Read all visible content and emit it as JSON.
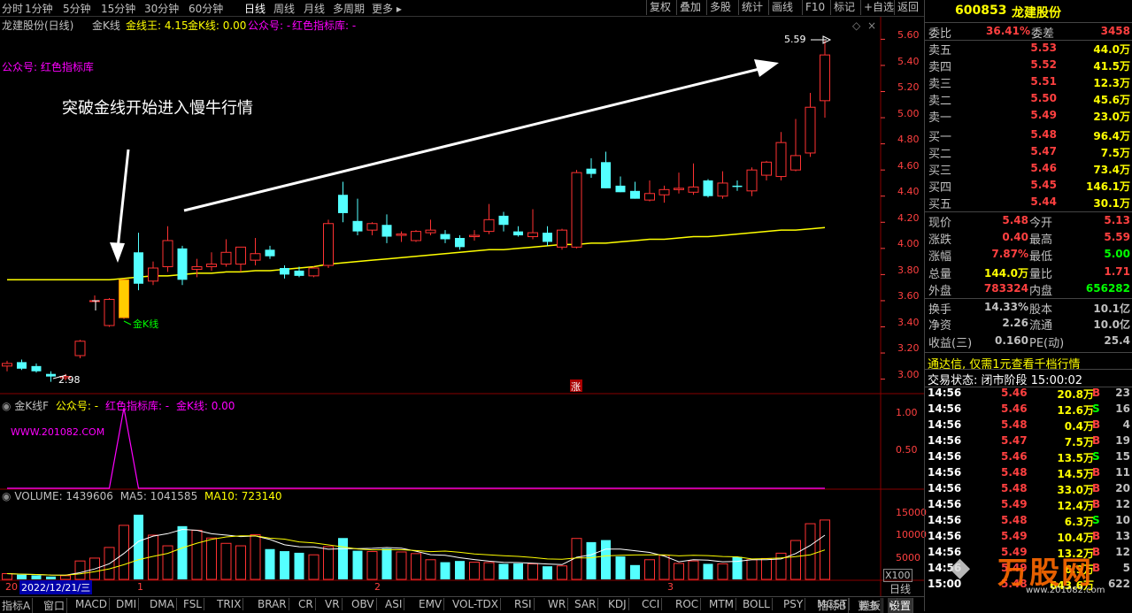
{
  "toolbar": {
    "periods": [
      "分时",
      "1分钟",
      "5分钟",
      "15分钟",
      "30分钟",
      "60分钟",
      "日线",
      "周线",
      "月线",
      "多周期",
      "更多 ▸"
    ],
    "active_period": "日线",
    "buttons": [
      "复权",
      "叠加",
      "多股",
      "统计",
      "画线",
      "F10",
      "标记",
      "+自选",
      "返回"
    ]
  },
  "main_header": {
    "stock": "龙建股份(日线)",
    "indicator": "金K线",
    "jxw_label": "金线王: 4.15",
    "jk_label": "金K线: 0.00",
    "gzh_label": "公众号: -",
    "red_label": "红色指标库: -",
    "side_label": "公众号: 红色指标库"
  },
  "annotations": {
    "headline": "突破金线开始进入慢牛行情",
    "jk_tag": "金K线",
    "high_mark": "5.59",
    "low_mark": "2.98",
    "zhang": "涨"
  },
  "price_axis": [
    "5.60",
    "5.40",
    "5.20",
    "5.00",
    "4.80",
    "4.60",
    "4.40",
    "4.20",
    "4.00",
    "3.80",
    "3.60",
    "3.40",
    "3.20",
    "3.00"
  ],
  "sub_header": {
    "name": "金K线F",
    "gzh": "公众号: -",
    "red": "红色指标库: -",
    "jk": "金K线: 0.00",
    "watermark": "WWW.201082.COM",
    "axis": [
      "1.00",
      "0.50"
    ]
  },
  "volume_header": {
    "volume": "VOLUME: 1439606",
    "ma5": "MA5: 1041585",
    "ma10": "MA10: 723140",
    "axis": [
      "15000",
      "10000",
      "5000"
    ],
    "unit": "X100"
  },
  "date_axis": {
    "date": "2022/12/21/三",
    "months": [
      "1",
      "2",
      "3"
    ],
    "left_fragment": "20"
  },
  "period_label": "日线",
  "stock_panel": {
    "code": "600853",
    "name": "龙建股份",
    "webi_label": "委比",
    "webi": "36.41%",
    "weicha_label": "委差",
    "weicha": "3458",
    "asks": [
      {
        "label": "卖五",
        "price": "5.53",
        "vol": "44.0万"
      },
      {
        "label": "卖四",
        "price": "5.52",
        "vol": "41.5万"
      },
      {
        "label": "卖三",
        "price": "5.51",
        "vol": "12.3万"
      },
      {
        "label": "卖二",
        "price": "5.50",
        "vol": "45.6万"
      },
      {
        "label": "卖一",
        "price": "5.49",
        "vol": "23.0万"
      }
    ],
    "bids": [
      {
        "label": "买一",
        "price": "5.48",
        "vol": "96.4万"
      },
      {
        "label": "买二",
        "price": "5.47",
        "vol": "7.5万"
      },
      {
        "label": "买三",
        "price": "5.46",
        "vol": "73.4万"
      },
      {
        "label": "买四",
        "price": "5.45",
        "vol": "146.1万"
      },
      {
        "label": "买五",
        "price": "5.44",
        "vol": "30.1万"
      }
    ],
    "stats": [
      {
        "l1": "现价",
        "v1": "5.48",
        "c1": "#ff4040",
        "l2": "今开",
        "v2": "5.13",
        "c2": "#ff4040"
      },
      {
        "l1": "涨跌",
        "v1": "0.40",
        "c1": "#ff4040",
        "l2": "最高",
        "v2": "5.59",
        "c2": "#ff4040"
      },
      {
        "l1": "涨幅",
        "v1": "7.87%",
        "c1": "#ff4040",
        "l2": "最低",
        "v2": "5.00",
        "c2": "#00ff00"
      },
      {
        "l1": "总量",
        "v1": "144.0万",
        "c1": "#ffff00",
        "l2": "量比",
        "v2": "1.71",
        "c2": "#ff4040"
      },
      {
        "l1": "外盘",
        "v1": "783324",
        "c1": "#ff4040",
        "l2": "内盘",
        "v2": "656282",
        "c2": "#00ff00"
      },
      {
        "l1": "换手",
        "v1": "14.33%",
        "c1": "#c0c0c0",
        "l2": "股本",
        "v2": "10.1亿",
        "c2": "#c0c0c0"
      },
      {
        "l1": "净资",
        "v1": "2.26",
        "c1": "#c0c0c0",
        "l2": "流通",
        "v2": "10.0亿",
        "c2": "#c0c0c0"
      },
      {
        "l1": "收益(三)",
        "v1": "0.160",
        "c1": "#c0c0c0",
        "l2": "PE(动)",
        "v2": "25.4",
        "c2": "#c0c0c0"
      }
    ],
    "promo": "通达信, 仅需1元查看千档行情",
    "status": "交易状态: 闭市阶段 15:00:02",
    "ticks": [
      {
        "t": "14:56",
        "p": "5.46",
        "v": "20.8万",
        "s": "B",
        "n": "23"
      },
      {
        "t": "14:56",
        "p": "5.46",
        "v": "12.6万",
        "s": "S",
        "n": "16"
      },
      {
        "t": "14:56",
        "p": "5.48",
        "v": "0.4万",
        "s": "B",
        "n": "4"
      },
      {
        "t": "14:56",
        "p": "5.47",
        "v": "7.5万",
        "s": "B",
        "n": "19"
      },
      {
        "t": "14:56",
        "p": "5.46",
        "v": "13.5万",
        "s": "S",
        "n": "15"
      },
      {
        "t": "14:56",
        "p": "5.48",
        "v": "14.5万",
        "s": "B",
        "n": "11"
      },
      {
        "t": "14:56",
        "p": "5.48",
        "v": "33.0万",
        "s": "B",
        "n": "20"
      },
      {
        "t": "14:56",
        "p": "5.49",
        "v": "12.4万",
        "s": "B",
        "n": "12"
      },
      {
        "t": "14:56",
        "p": "5.48",
        "v": "6.3万",
        "s": "S",
        "n": "10"
      },
      {
        "t": "14:56",
        "p": "5.49",
        "v": "10.4万",
        "s": "B",
        "n": "13"
      },
      {
        "t": "14:56",
        "p": "5.49",
        "v": "13.2万",
        "s": "B",
        "n": "12"
      },
      {
        "t": "14:56",
        "p": "5.49",
        "v": "6.9万",
        "s": "B",
        "n": "5"
      },
      {
        "t": "15:00",
        "p": "5.48",
        "v": "643.6万",
        "s": "",
        "n": "622"
      }
    ],
    "logo_text": "万股网",
    "logo_url": "www.201082.com"
  },
  "bottom_tabs": [
    "指标A",
    "窗口",
    "MACD",
    "DMI",
    "DMA",
    "FSL",
    "TRIX",
    "BRAR",
    "CR",
    "VR",
    "OBV",
    "ASI",
    "EMV",
    "VOL-TDX",
    "RSI",
    "WR",
    "SAR",
    "KDJ",
    "CCI",
    "ROC",
    "MTM",
    "BOLL",
    "PSY",
    "MCST",
    "更多",
    "设置"
  ],
  "active_tab": "设置",
  "bottom_right_tabs": [
    "指标B",
    "模板",
    "▸"
  ],
  "colors": {
    "up": "#ff3232",
    "down": "#54ffff",
    "gold": "#ffff00",
    "magenta": "#ff00ff",
    "grid": "#880000"
  },
  "chart_data": {
    "type": "candlestick",
    "ylim": [
      2.95,
      5.65
    ],
    "candles": [
      {
        "o": 3.1,
        "h": 3.14,
        "l": 3.06,
        "c": 3.12
      },
      {
        "o": 3.13,
        "h": 3.15,
        "l": 3.07,
        "c": 3.08
      },
      {
        "o": 3.1,
        "h": 3.12,
        "l": 3.05,
        "c": 3.06
      },
      {
        "o": 3.04,
        "h": 3.06,
        "l": 2.98,
        "c": 3.02
      },
      {
        "o": 3.01,
        "h": 3.04,
        "l": 2.99,
        "c": 3.02
      },
      {
        "o": 3.18,
        "h": 3.3,
        "l": 3.16,
        "c": 3.29
      },
      {
        "o": 3.6,
        "h": 3.64,
        "l": 3.59,
        "c": 3.6
      },
      {
        "o": 3.41,
        "h": 3.62,
        "l": 3.4,
        "c": 3.61
      },
      {
        "o": 3.47,
        "h": 3.77,
        "l": 3.46,
        "c": 3.76
      },
      {
        "o": 3.97,
        "h": 4.12,
        "l": 3.68,
        "c": 3.73
      },
      {
        "o": 3.75,
        "h": 3.9,
        "l": 3.72,
        "c": 3.85
      },
      {
        "o": 3.86,
        "h": 4.17,
        "l": 3.82,
        "c": 4.06
      },
      {
        "o": 4.0,
        "h": 4.02,
        "l": 3.72,
        "c": 3.76
      },
      {
        "o": 3.84,
        "h": 3.92,
        "l": 3.78,
        "c": 3.86
      },
      {
        "o": 3.86,
        "h": 3.97,
        "l": 3.83,
        "c": 3.88
      },
      {
        "o": 3.88,
        "h": 4.07,
        "l": 3.86,
        "c": 3.97
      },
      {
        "o": 3.88,
        "h": 4.0,
        "l": 3.82,
        "c": 4.01
      },
      {
        "o": 3.91,
        "h": 4.08,
        "l": 3.87,
        "c": 3.96
      },
      {
        "o": 3.99,
        "h": 4.02,
        "l": 3.92,
        "c": 3.94
      },
      {
        "o": 3.85,
        "h": 3.87,
        "l": 3.77,
        "c": 3.8
      },
      {
        "o": 3.83,
        "h": 3.86,
        "l": 3.78,
        "c": 3.79
      },
      {
        "o": 3.79,
        "h": 3.86,
        "l": 3.78,
        "c": 3.85
      },
      {
        "o": 3.87,
        "h": 4.22,
        "l": 3.85,
        "c": 4.19
      },
      {
        "o": 4.41,
        "h": 4.51,
        "l": 4.2,
        "c": 4.27
      },
      {
        "o": 4.21,
        "h": 4.38,
        "l": 4.1,
        "c": 4.13
      },
      {
        "o": 4.14,
        "h": 4.2,
        "l": 4.1,
        "c": 4.19
      },
      {
        "o": 4.18,
        "h": 4.26,
        "l": 4.04,
        "c": 4.09
      },
      {
        "o": 4.1,
        "h": 4.13,
        "l": 4.05,
        "c": 4.11
      },
      {
        "o": 4.06,
        "h": 4.14,
        "l": 4.05,
        "c": 4.13
      },
      {
        "o": 4.12,
        "h": 4.22,
        "l": 4.1,
        "c": 4.14
      },
      {
        "o": 4.11,
        "h": 4.14,
        "l": 4.04,
        "c": 4.07
      },
      {
        "o": 4.08,
        "h": 4.1,
        "l": 3.99,
        "c": 4.01
      },
      {
        "o": 4.09,
        "h": 4.14,
        "l": 4.06,
        "c": 4.1
      },
      {
        "o": 4.13,
        "h": 4.34,
        "l": 4.11,
        "c": 4.22
      },
      {
        "o": 4.25,
        "h": 4.28,
        "l": 4.13,
        "c": 4.18
      },
      {
        "o": 4.13,
        "h": 4.17,
        "l": 4.09,
        "c": 4.1
      },
      {
        "o": 4.09,
        "h": 4.3,
        "l": 4.07,
        "c": 4.12
      },
      {
        "o": 4.12,
        "h": 4.17,
        "l": 4.02,
        "c": 4.05
      },
      {
        "o": 4.01,
        "h": 4.15,
        "l": 3.99,
        "c": 4.14
      },
      {
        "o": 4.01,
        "h": 4.6,
        "l": 4.0,
        "c": 4.58
      },
      {
        "o": 4.61,
        "h": 4.69,
        "l": 4.54,
        "c": 4.57
      },
      {
        "o": 4.66,
        "h": 4.74,
        "l": 4.46,
        "c": 4.46
      },
      {
        "o": 4.48,
        "h": 4.55,
        "l": 4.43,
        "c": 4.43
      },
      {
        "o": 4.44,
        "h": 4.51,
        "l": 4.38,
        "c": 4.38
      },
      {
        "o": 4.37,
        "h": 4.52,
        "l": 4.36,
        "c": 4.42
      },
      {
        "o": 4.41,
        "h": 4.48,
        "l": 4.35,
        "c": 4.45
      },
      {
        "o": 4.45,
        "h": 4.58,
        "l": 4.42,
        "c": 4.46
      },
      {
        "o": 4.43,
        "h": 4.65,
        "l": 4.41,
        "c": 4.47
      },
      {
        "o": 4.52,
        "h": 4.53,
        "l": 4.39,
        "c": 4.4
      },
      {
        "o": 4.4,
        "h": 4.59,
        "l": 4.38,
        "c": 4.5
      },
      {
        "o": 4.48,
        "h": 4.52,
        "l": 4.44,
        "c": 4.47
      },
      {
        "o": 4.44,
        "h": 4.62,
        "l": 4.4,
        "c": 4.6
      },
      {
        "o": 4.56,
        "h": 4.67,
        "l": 4.52,
        "c": 4.66
      },
      {
        "o": 4.55,
        "h": 4.89,
        "l": 4.52,
        "c": 4.81
      },
      {
        "o": 4.6,
        "h": 4.99,
        "l": 4.59,
        "c": 4.71
      },
      {
        "o": 4.73,
        "h": 5.19,
        "l": 4.7,
        "c": 5.08
      },
      {
        "o": 5.13,
        "h": 5.59,
        "l": 5.0,
        "c": 5.48
      }
    ],
    "golden_line": [
      3.76,
      3.76,
      3.76,
      3.76,
      3.76,
      3.76,
      3.76,
      3.76,
      3.77,
      3.78,
      3.79,
      3.79,
      3.8,
      3.81,
      3.81,
      3.82,
      3.82,
      3.83,
      3.83,
      3.84,
      3.85,
      3.86,
      3.88,
      3.89,
      3.9,
      3.91,
      3.92,
      3.93,
      3.94,
      3.95,
      3.96,
      3.97,
      3.98,
      3.99,
      3.99,
      4.0,
      4.01,
      4.02,
      4.03,
      4.03,
      4.04,
      4.04,
      4.05,
      4.06,
      4.07,
      4.07,
      4.08,
      4.09,
      4.09,
      4.1,
      4.11,
      4.12,
      4.13,
      4.14,
      4.14,
      4.15,
      4.16
    ],
    "sub_signal": {
      "index": 8,
      "value": 1.0
    },
    "sub_ylim": [
      0,
      1.1
    ],
    "volume": [
      1400,
      1150,
      1000,
      700,
      900,
      4500,
      5200,
      7800,
      13200,
      15800,
      10800,
      8200,
      13000,
      12000,
      10100,
      8800,
      8200,
      10900,
      7400,
      6900,
      6500,
      6000,
      8000,
      10100,
      7000,
      6800,
      7500,
      6700,
      6300,
      4800,
      4200,
      4500,
      4200,
      4100,
      3800,
      3900,
      3800,
      3200,
      3300,
      10000,
      9100,
      9600,
      5600,
      3500,
      4800,
      5900,
      3900,
      4500,
      3800,
      3800,
      5500,
      4800,
      5100,
      6400,
      9500,
      13600,
      14500
    ],
    "vol_ylim": [
      0,
      17500
    ],
    "vol_ma5": [
      1400,
      1270,
      1180,
      1060,
      1030,
      1650,
      2560,
      3820,
      6320,
      9300,
      10560,
      11160,
      12200,
      12000,
      11140,
      10820,
      10460,
      10600,
      9740,
      8440,
      7980,
      7940,
      7360,
      7500,
      7520,
      7580,
      7780,
      7620,
      6900,
      6020,
      5900,
      5300,
      4840,
      4460,
      4160,
      4100,
      3960,
      3760,
      3600,
      5400,
      6000,
      7400,
      7400,
      7000,
      6600,
      5700,
      4300,
      4800,
      4700,
      4300,
      4400,
      4800,
      4800,
      5000,
      6300,
      8300,
      10800
    ],
    "vol_ma10": [
      1400,
      1270,
      1180,
      1060,
      1030,
      1350,
      1870,
      2580,
      3590,
      4810,
      5610,
      6350,
      7700,
      8840,
      9770,
      10380,
      10650,
      10620,
      10060,
      9840,
      9150,
      8930,
      8420,
      7920,
      7430,
      7220,
      7250,
      7240,
      7050,
      6790,
      6920,
      6610,
      6230,
      5980,
      5790,
      5610,
      5330,
      5000,
      4920,
      5250,
      5280,
      5740,
      5880,
      5970,
      6010,
      6000,
      5740,
      5880,
      5820,
      5590,
      5520,
      5000,
      5080,
      5250,
      5550,
      6000,
      7190
    ]
  }
}
